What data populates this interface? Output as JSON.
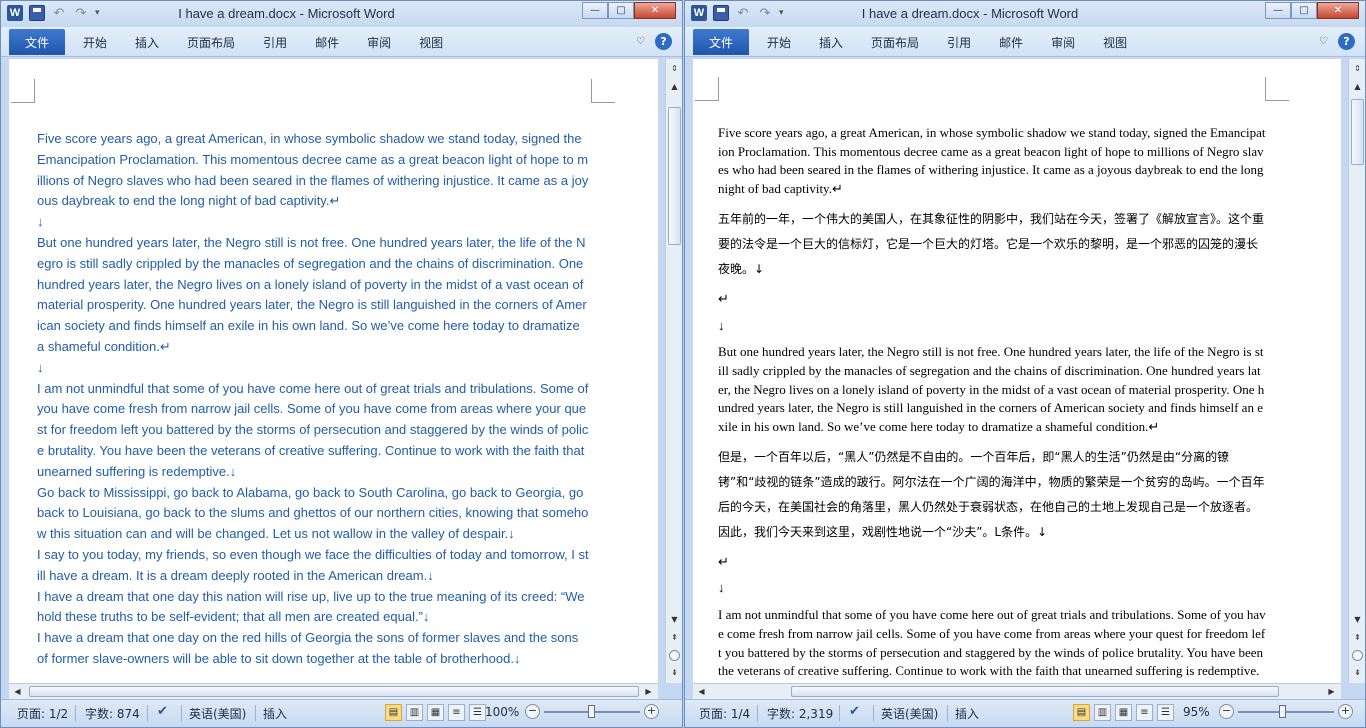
{
  "windows": [
    {
      "title": "I have a dream.docx  -  Microsoft Word",
      "tabs": [
        "文件",
        "开始",
        "插入",
        "页面布局",
        "引用",
        "邮件",
        "审阅",
        "视图"
      ],
      "status": {
        "page": "页面: 1/2",
        "words": "字数: 874",
        "language": "英语(美国)",
        "mode": "插入",
        "zoom": "100%"
      },
      "zoom_level_percent": 100,
      "paragraphs": [
        {
          "text": "Five score years ago, a great American, in whose symbolic shadow we stand today, signed the Emancipation Proclamation. This momentous decree came as a great beacon light of hope to millions of Negro slaves who had been seared in the flames of withering injustice. It came as a joyous daybreak to end the long night of bad captivity.↵"
        },
        {
          "text": "↓"
        },
        {
          "text": "    But one hundred years later, the Negro still is not free. One hundred years later, the life of the Negro is still sadly crippled by the manacles of segregation and the chains of discrimination. One hundred years later, the Negro lives on a lonely island of poverty in the midst of a vast ocean of material prosperity. One hundred years later, the Negro is still languished in the corners of American society and finds himself an exile in his own land. So we’ve come here today to dramatize  a shameful condition.↵"
        },
        {
          "text": "↓"
        },
        {
          "text": "    I am not unmindful that some of you have come here out of great trials and tribulations. Some of you have come fresh from narrow jail cells. Some of you have come from areas where your quest for freedom left you battered by the storms of persecution and staggered by the winds of police brutality. You have been the veterans of creative suffering. Continue to work with the faith that unearned suffering is redemptive.↓"
        },
        {
          "text": "Go back to Mississippi, go back to Alabama, go back to South Carolina, go back to Georgia, go back to Louisiana, go back to the slums and ghettos of our northern cities, knowing that somehow this situation can and will be changed. Let us not wallow in the valley of despair.↓"
        },
        {
          "text": "I say to you today, my friends, so even though we face the difficulties of today and tomorrow, I still have a dream. It is a dream deeply rooted in the American dream.↓"
        },
        {
          "text": "    I have a dream that one day this nation will rise up, live up to the true meaning of its creed: “We hold these truths to be self-evident; that all men are created equal.”↓"
        },
        {
          "text": "    I have a dream that one day on the red hills of Georgia the sons of former slaves and the sons of former slave-owners will be able to sit down together at the table of brotherhood.↓"
        }
      ]
    },
    {
      "title": "I have a dream.docx  -  Microsoft Word",
      "tabs": [
        "文件",
        "开始",
        "插入",
        "页面布局",
        "引用",
        "邮件",
        "审阅",
        "视图"
      ],
      "status": {
        "page": "页面: 1/4",
        "words": "字数: 2,319",
        "language": "英语(美国)",
        "mode": "插入",
        "zoom": "95%"
      },
      "zoom_level_percent": 95,
      "paragraphs": [
        {
          "text": "Five score years ago, a great American, in whose symbolic shadow we stand today, signed the Emancipation Proclamation. This momentous decree came as a great beacon light of hope to millions of Negro slaves who had been seared in the flames of withering injustice. It came as a joyous daybreak to end the long night of bad captivity.↵",
          "cn": false
        },
        {
          "text": "五年前的一年，一个伟大的美国人，在其象征性的阴影中，我们站在今天，签署了《解放宣言》。这个重要的法令是一个巨大的信标灯，它是一个巨大的灯塔。它是一个欢乐的黎明，是一个邪恶的囚笼的漫长夜晚。↓",
          "cn": true
        },
        {
          "text": "↵",
          "cn": false
        },
        {
          "text": "↓",
          "cn": false
        },
        {
          "text": "    But one hundred years later, the Negro still is not free. One hundred years later, the life of the Negro is still sadly crippled by the manacles of segregation and the chains of discrimination. One hundred years later, the Negro lives on a lonely island of poverty in the midst of a vast ocean of material prosperity. One hundred years later, the Negro is still languished in the corners of American society and finds himself an exile in his own land. So we’ve come here today to dramatize a shameful condition.↵",
          "cn": false
        },
        {
          "text": "但是，一个百年以后，“黑人”仍然是不自由的。一个百年后，即“黑人的生活”仍然是由“分离的镣铐”和“歧视的链条”造成的跛行。阿尔法在一个广阔的海洋中，物质的繁荣是一个贫穷的岛屿。一个百年后的今天，在美国社会的角落里，黑人仍然处于衰弱状态，在他自己的土地上发现自己是一个放逐者。因此，我们今天来到这里，戏剧性地说一个“沙夫”。L条件。↓",
          "cn": true
        },
        {
          "text": "↵",
          "cn": false
        },
        {
          "text": "↓",
          "cn": false
        },
        {
          "text": "    I am not unmindful that some of you have come here out of great trials and tribulations. Some of you have come fresh from narrow jail cells. Some of you have come from areas where your quest for freedom left you battered by the storms of persecution and staggered by the winds of police brutality. You have been the veterans of creative suffering. Continue to work with the faith that unearned suffering is redemptive.",
          "cn": false
        }
      ]
    }
  ],
  "icons": [
    "word-logo-icon",
    "save-icon",
    "undo-icon",
    "redo-icon",
    "minimize-icon",
    "maximize-icon",
    "close-icon",
    "ribbon-collapse-icon",
    "help-icon",
    "proofing-icon",
    "zoom-out-icon",
    "zoom-in-icon"
  ],
  "glyphs": {
    "word_logo": "W",
    "undo": "↶",
    "redo": "↷",
    "qat_more": "▾",
    "minimize": "—",
    "maximize": "□",
    "close": "✕",
    "ribbon_collapse": "♡",
    "help": "?",
    "proofing": "✔",
    "zoom_out": "−",
    "zoom_in": "+",
    "scroll_up": "▲",
    "scroll_down": "▼",
    "scroll_left": "◀",
    "scroll_right": "▶",
    "prev_page": "⇞",
    "next_page": "⇟",
    "view_print": "▤",
    "view_reading": "▥",
    "view_web": "▦",
    "view_outline": "≡",
    "view_draft": "☰",
    "split": "⇕"
  },
  "colors": {
    "file_tab": "#2b5797",
    "doc_text_left": "#215da8",
    "doc_text_right": "#000000",
    "active_view": "#fbdc84"
  }
}
